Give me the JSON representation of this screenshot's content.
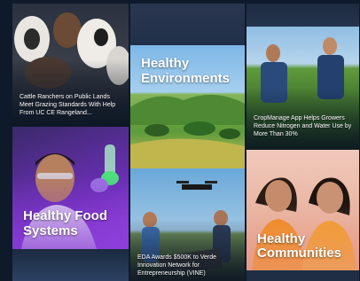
{
  "tiles": {
    "cattle": {
      "caption": "Cattle Ranchers on Public Lands Meet Grazing Standards With Help From UC CE Rangeland..."
    },
    "environments": {
      "title_line1": "Healthy",
      "title_line2": "Environments"
    },
    "cropmanage": {
      "caption": "CropManage App Helps Growers Reduce Nitrogen and Water Use by More Than 30%"
    },
    "food": {
      "title_line1": "Healthy Food",
      "title_line2": "Systems"
    },
    "eda": {
      "caption": "EDA Awards $500K to Verde Innovation Network for Entrepreneurship (VINE)"
    },
    "communities": {
      "title_line1": "Healthy",
      "title_line2": "Communities"
    }
  },
  "colors": {
    "food_overlay": "#8a3bd6",
    "communities_overlay": "#e79a86",
    "environments_sky": "#7db7e6",
    "field_green": "#5d9b3a"
  }
}
